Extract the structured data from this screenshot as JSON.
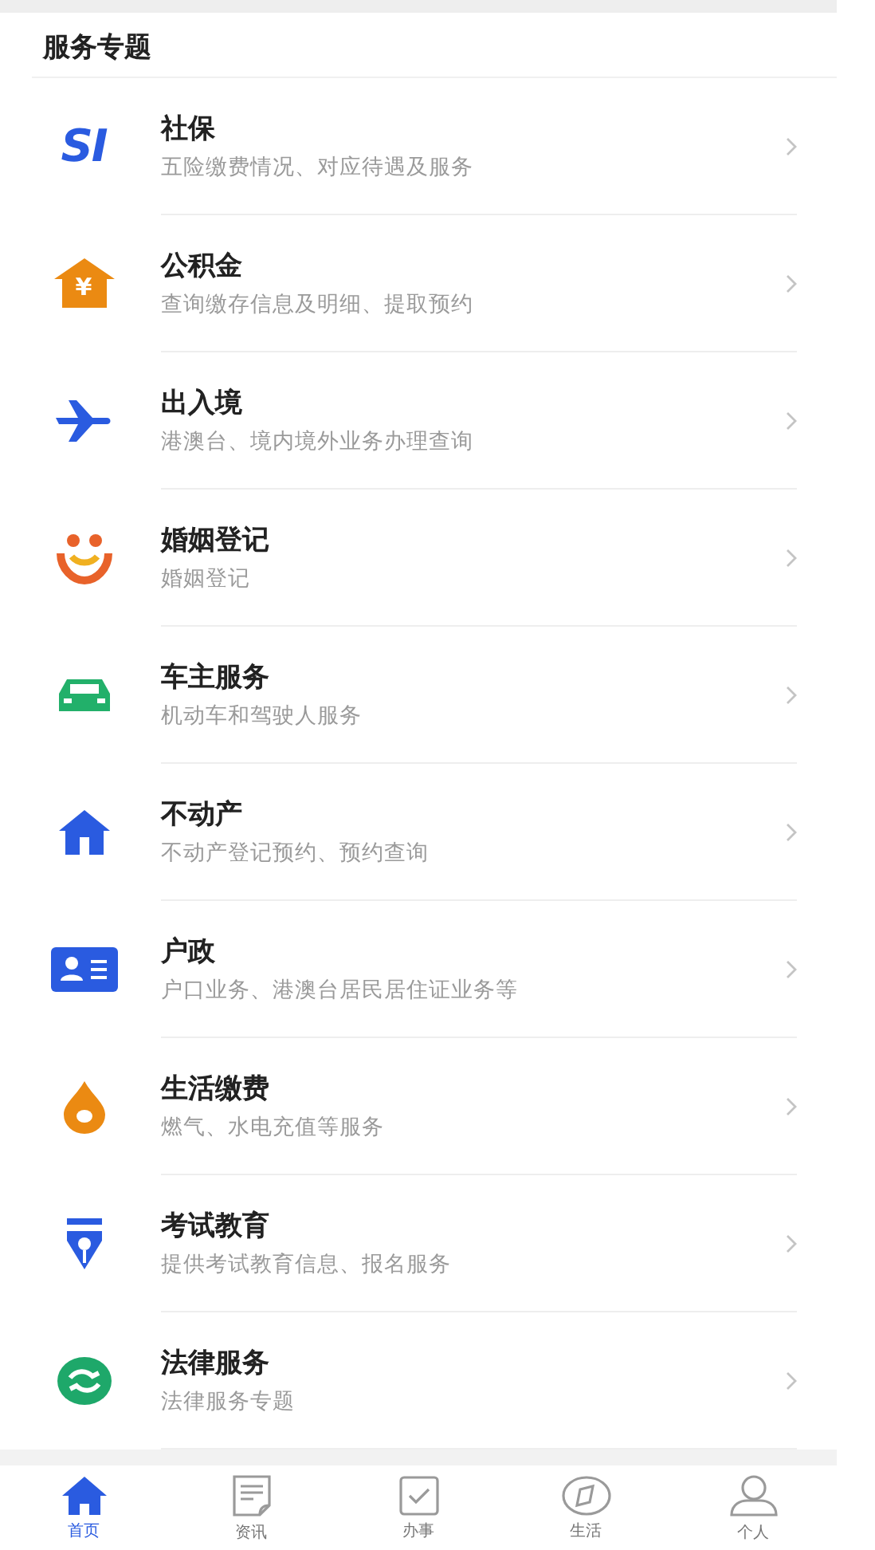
{
  "section": {
    "title": "服务专题"
  },
  "services": [
    {
      "kind": "si",
      "icon_text": "SI",
      "title": "社保",
      "subtitle": "五险缴费情况、对应待遇及服务"
    },
    {
      "kind": "fund",
      "icon_text": "¥",
      "title": "公积金",
      "subtitle": "查询缴存信息及明细、提取预约"
    },
    {
      "kind": "plane",
      "title": "出入境",
      "subtitle": "港澳台、境内境外业务办理查询"
    },
    {
      "kind": "marriage",
      "title": "婚姻登记",
      "subtitle": "婚姻登记"
    },
    {
      "kind": "car",
      "title": "车主服务",
      "subtitle": "机动车和驾驶人服务"
    },
    {
      "kind": "home",
      "title": "不动产",
      "subtitle": "不动产登记预约、预约查询"
    },
    {
      "kind": "idcard",
      "title": "户政",
      "subtitle": "户口业务、港澳台居民居住证业务等"
    },
    {
      "kind": "drop",
      "title": "生活缴费",
      "subtitle": "燃气、水电充值等服务"
    },
    {
      "kind": "pen",
      "title": "考试教育",
      "subtitle": "提供考试教育信息、报名服务"
    },
    {
      "kind": "legal",
      "title": "法律服务",
      "subtitle": "法律服务专题"
    }
  ],
  "tabs": [
    {
      "kind": "home",
      "label": "首页",
      "selected": true
    },
    {
      "kind": "news",
      "label": "资讯",
      "selected": false
    },
    {
      "kind": "tasks",
      "label": "办事",
      "selected": false
    },
    {
      "kind": "life",
      "label": "生活",
      "selected": false
    },
    {
      "kind": "person",
      "label": "个人",
      "selected": false
    }
  ]
}
